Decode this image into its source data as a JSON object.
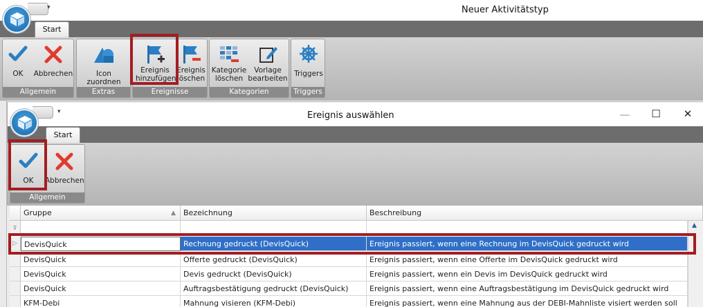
{
  "main_window": {
    "title": "Neuer Aktivitätstyp",
    "tab": "Start",
    "groups": [
      {
        "label": "Allgemein",
        "buttons": [
          {
            "label": "OK",
            "icon": "check-icon"
          },
          {
            "label": "Abbrechen",
            "icon": "cross-icon"
          }
        ]
      },
      {
        "label": "Extras",
        "buttons": [
          {
            "label": "Icon zuordnen",
            "icon": "shapes-icon"
          }
        ]
      },
      {
        "label": "Ereignisse",
        "buttons": [
          {
            "label_line1": "Ereignis",
            "label_line2": "hinzufügen",
            "icon": "flag-add-icon"
          },
          {
            "label_line1": "Ereignis",
            "label_line2": "löschen",
            "icon": "flag-remove-icon"
          }
        ]
      },
      {
        "label": "Kategorien",
        "buttons": [
          {
            "label_line1": "Kategorie",
            "label_line2": "löschen",
            "icon": "grid-remove-icon"
          },
          {
            "label_line1": "Vorlage",
            "label_line2": "bearbeiten",
            "icon": "edit-icon"
          }
        ]
      },
      {
        "label": "Triggers",
        "buttons": [
          {
            "label": "Triggers",
            "icon": "ship-wheel-icon"
          }
        ]
      }
    ]
  },
  "dialog": {
    "title": "Ereignis auswählen",
    "tab": "Start",
    "controls": {
      "minimize": "—",
      "maximize": "☐",
      "close": "✕"
    },
    "group": {
      "label": "Allgemein",
      "buttons": [
        {
          "label": "OK",
          "icon": "check-icon"
        },
        {
          "label": "Abbrechen",
          "icon": "cross-icon"
        }
      ]
    }
  },
  "grid": {
    "columns": [
      "Gruppe",
      "Bezeichnung",
      "Beschreibung"
    ],
    "rows": [
      {
        "gruppe": "DevisQuick",
        "bezeichnung": "Rechnung gedruckt (DevisQuick)",
        "beschreibung": "Ereignis passiert, wenn eine Rechnung im DevisQuick gedruckt wird",
        "selected": true
      },
      {
        "gruppe": "DevisQuick",
        "bezeichnung": "Offerte gedruckt (DevisQuick)",
        "beschreibung": "Ereignis passiert, wenn eine Offerte im DevisQuick gedruckt wird"
      },
      {
        "gruppe": "DevisQuick",
        "bezeichnung": "Devis gedruckt (DevisQuick)",
        "beschreibung": "Ereignis passiert, wenn ein Devis im DevisQuick gedruckt wird"
      },
      {
        "gruppe": "DevisQuick",
        "bezeichnung": "Auftragsbestätigung gedruckt (DevisQuick)",
        "beschreibung": "Ereignis passiert, wenn eine Auftragsbestätigung im DevisQuick gedruckt wird"
      },
      {
        "gruppe": "KFM-Debi",
        "bezeichnung": "Mahnung visieren (KFM-Debi)",
        "beschreibung": "Ereignis passiert, wenn eine Mahnung aus der DEBI-Mahnliste visiert werden soll"
      }
    ]
  },
  "colors": {
    "highlight": "#a31d22",
    "selection": "#2f6fc7",
    "accent_blue": "#2b7fc4",
    "red": "#e03a2f"
  }
}
